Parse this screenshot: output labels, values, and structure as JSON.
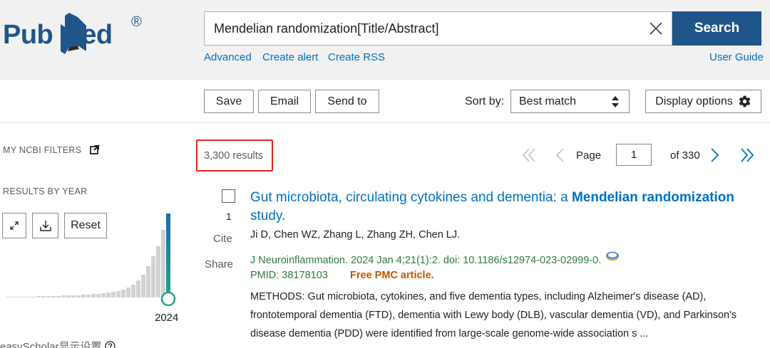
{
  "brand": {
    "name_left": "Pub",
    "name_right": "ed",
    "registered": "®"
  },
  "search": {
    "query": "Mendelian randomization[Title/Abstract]",
    "button_label": "Search"
  },
  "subnav": {
    "advanced": "Advanced",
    "create_alert": "Create alert",
    "create_rss": "Create RSS",
    "user_guide": "User Guide"
  },
  "toolbar": {
    "save": "Save",
    "email": "Email",
    "send_to": "Send to",
    "sort_label": "Sort by:",
    "sort_value": "Best match",
    "display_options": "Display options"
  },
  "sidebar": {
    "my_ncbi_filters": "MY NCBI FILTERS",
    "results_by_year": "RESULTS BY YEAR",
    "reset": "Reset",
    "year_label": "2024",
    "easyscholar": "easyScholar显示设置"
  },
  "results": {
    "count": "3,300 results",
    "pager": {
      "page_label": "Page",
      "current": "1",
      "of_label": "of 330"
    },
    "items": [
      {
        "number": "1",
        "title_plain": "Gut microbiota, circulating cytokines and dementia: a ",
        "title_bold": "Mendelian randomization",
        "title_end": " study.",
        "authors": "Ji D, Chen WZ, Zhang L, Zhang ZH, Chen LJ.",
        "journal": "J Neuroinflammation. 2024 Jan 4;21(1):2. doi: 10.1186/s12974-023-02999-0.",
        "pmid": "PMID: 38178103",
        "free_pmc": "Free PMC article.",
        "snippet": "METHODS: Gut microbiota, cytokines, and five dementia types, including Alzheimer's disease (AD), frontotemporal dementia (FTD), dementia with Lewy body (DLB), vascular dementia (VD), and Parkinson's disease dementia (PDD) were identified from large-scale genome-wide association s ...",
        "cite": "Cite",
        "share": "Share"
      }
    ]
  },
  "colors": {
    "brand_blue": "#20558a",
    "link_blue": "#0071bc",
    "citation_green": "#2d7a3e",
    "free_pmc_orange": "#c05600",
    "highlight_red": "#e1241b",
    "year_bar_gray": "#d2d2d2",
    "year_bar_accent": "#1b6eae"
  },
  "icons": {
    "clear": "close-icon",
    "sort": "sort-arrows-icon",
    "display": "gear-icon",
    "external": "external-link-icon",
    "expand": "expand-icon",
    "download": "download-icon",
    "first": "double-chevron-left-icon",
    "prev": "chevron-left-icon",
    "next": "chevron-right-icon",
    "last": "double-chevron-right-icon",
    "help": "help-circle-icon",
    "ezproxy": "ezproxy-icon"
  }
}
